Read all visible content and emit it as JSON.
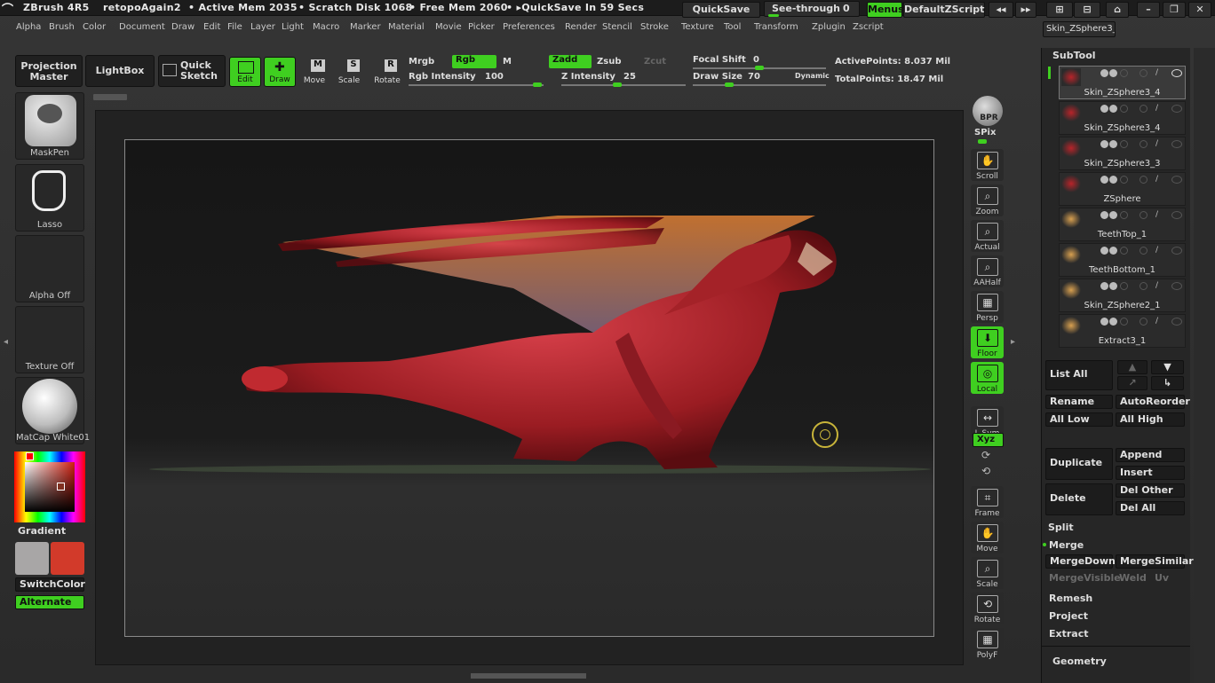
{
  "title_bar": {
    "app": "ZBrush 4R5",
    "doc": "retopoAgain2",
    "active_mem": "• Active Mem 2035",
    "scratch": "• Scratch Disk 1068",
    "free_mem": "• Free Mem 2060",
    "quicksave_timer": "• ▸QuickSave In 59 Secs",
    "quicksave_btn": "QuickSave",
    "see_through": "See-through",
    "see_through_val": "0",
    "menus_btn": "Menus",
    "zscript_btn": "DefaultZScript",
    "current_tool": "Skin_ZSphere3_4"
  },
  "menu": [
    "Alpha",
    "Brush",
    "Color",
    "Document",
    "Draw",
    "Edit",
    "File",
    "Layer",
    "Light",
    "Macro",
    "Marker",
    "Material",
    "Movie",
    "Picker",
    "Preferences",
    "Render",
    "Stencil",
    "Stroke",
    "Texture",
    "Tool",
    "Transform",
    "Zplugin",
    "Zscript"
  ],
  "toolbar": {
    "projection_master": "Projection Master",
    "lightbox": "LightBox",
    "quick_sketch": "Quick Sketch",
    "edit": "Edit",
    "draw": "Draw",
    "move": "Move",
    "scale": "Scale",
    "rotate": "Rotate",
    "mrgb": "Mrgb",
    "rgb": "Rgb",
    "m": "M",
    "rgb_intensity_label": "Rgb Intensity",
    "rgb_intensity": "100",
    "zadd": "Zadd",
    "zsub": "Zsub",
    "zcut": "Zcut",
    "z_intensity_label": "Z Intensity",
    "z_intensity": "25",
    "focal_shift_label": "Focal Shift",
    "focal_shift": "0",
    "draw_size_label": "Draw Size",
    "draw_size": "70",
    "dynamic": "Dynamic",
    "active_points": "ActivePoints: 8.037 Mil",
    "total_points": "TotalPoints: 18.47 Mil"
  },
  "left_shelf": {
    "brush": "MaskPen",
    "stroke": "Lasso",
    "alpha": "Alpha Off",
    "texture": "Texture Off",
    "material": "MatCap White01",
    "gradient": "Gradient",
    "switch_color": "SwitchColor",
    "alternate": "Alternate",
    "colors": {
      "primary": "#a8a6a6",
      "secondary": "#d23a2a"
    }
  },
  "right_shelf": [
    "BPR",
    "SPix",
    "Scroll",
    "Zoom",
    "Actual",
    "AAHalf",
    "Persp",
    "Floor",
    "Local",
    "L.Sym",
    "Xyz",
    "Frame",
    "Move",
    "Scale",
    "Rotate",
    "PolyF"
  ],
  "subtool": {
    "header": "SubTool",
    "items": [
      "Skin_ZSphere3_4",
      "Skin_ZSphere3_4",
      "Skin_ZSphere3_3",
      "ZSphere",
      "TeethTop_1",
      "TeethBottom_1",
      "Skin_ZSphere2_1",
      "Extract3_1"
    ],
    "list_all": "List All",
    "rename": "Rename",
    "auto_reorder": "AutoReorder",
    "all_low": "All Low",
    "all_high": "All High",
    "duplicate": "Duplicate",
    "append": "Append",
    "insert": "Insert",
    "delete": "Delete",
    "del_other": "Del Other",
    "del_all": "Del All",
    "split": "Split",
    "merge": "Merge",
    "merge_down": "MergeDown",
    "merge_similar": "MergeSimilar",
    "merge_visible": "MergeVisible",
    "weld": "Weld",
    "uv": "Uv",
    "remesh": "Remesh",
    "project": "Project",
    "extract": "Extract",
    "geometry": "Geometry"
  },
  "accent": "#3fcf20"
}
